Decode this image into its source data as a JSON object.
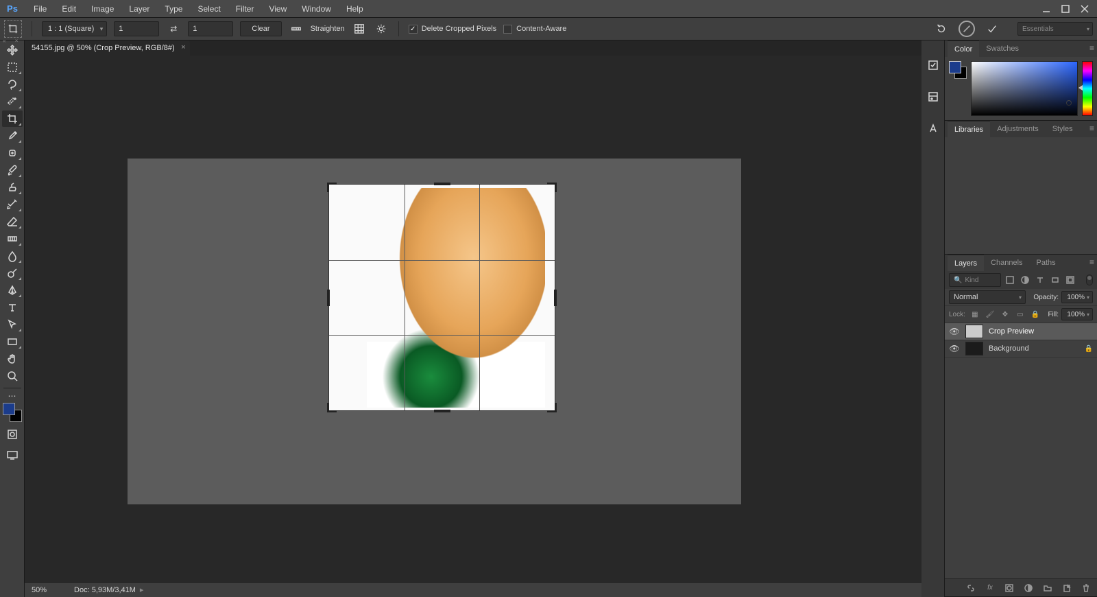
{
  "menu": {
    "items": [
      "File",
      "Edit",
      "Image",
      "Layer",
      "Type",
      "Select",
      "Filter",
      "View",
      "Window",
      "Help"
    ]
  },
  "options": {
    "ratioPreset": "1 : 1 (Square)",
    "width": "1",
    "height": "1",
    "clearLabel": "Clear",
    "straightenLabel": "Straighten",
    "deleteCroppedLabel": "Delete Cropped Pixels",
    "deleteCroppedChecked": true,
    "contentAwareLabel": "Content-Aware",
    "contentAwareChecked": false,
    "workspace": "Essentials"
  },
  "doc": {
    "tabTitle": "54155.jpg @ 50% (Crop Preview, RGB/8#)"
  },
  "panels": {
    "colorTabs": [
      "Color",
      "Swatches"
    ],
    "libTabs": [
      "Libraries",
      "Adjustments",
      "Styles"
    ],
    "layerTabs": [
      "Layers",
      "Channels",
      "Paths"
    ],
    "kindPlaceholder": "Kind",
    "blendMode": "Normal",
    "opacityLabel": "Opacity:",
    "opacityValue": "100%",
    "fillLabel": "Fill:",
    "fillValue": "100%",
    "lockLabel": "Lock:",
    "layers": [
      {
        "name": "Crop Preview",
        "selected": true,
        "dark": false,
        "locked": false
      },
      {
        "name": "Background",
        "selected": false,
        "dark": true,
        "locked": true
      }
    ]
  },
  "status": {
    "zoom": "50%",
    "docSize": "Doc: 5,93M/3,41M"
  }
}
